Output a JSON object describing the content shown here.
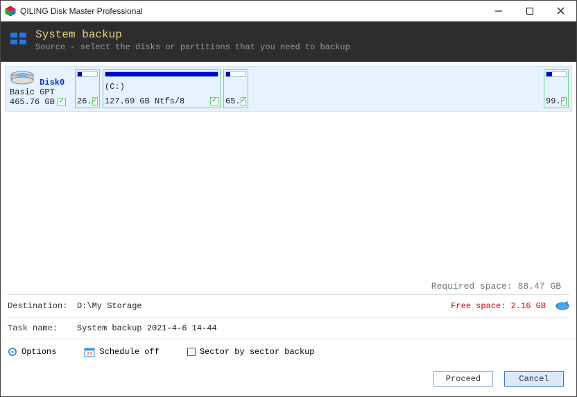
{
  "titlebar": {
    "title": "QILING Disk Master Professional"
  },
  "header": {
    "title": "System backup",
    "subtitle": "Source - select the disks or partitions that you need to backup"
  },
  "disk": {
    "name": "Disk0",
    "type": "Basic GPT",
    "capacity": "465.76 GB"
  },
  "partitions": {
    "p1": {
      "label": "26.",
      "fill": 20
    },
    "p2": {
      "drive": "(C:)",
      "label": "127.69 GB Ntfs/8",
      "fill": 100
    },
    "p3": {
      "label": "65.",
      "fill": 22
    },
    "p4": {
      "label": "99.",
      "fill": 30
    }
  },
  "required": "Required space: 88.47 GB",
  "destination": {
    "label": "Destination:",
    "value": "D:\\My Storage",
    "free": "Free space: 2.16 GB"
  },
  "task": {
    "label": "Task name:",
    "value": "System backup 2021-4-6 14-44"
  },
  "options": {
    "options_label": "Options",
    "schedule_label": "Schedule off",
    "sector_label": "Sector by sector backup"
  },
  "buttons": {
    "proceed": "Proceed",
    "cancel": "Cancel"
  }
}
